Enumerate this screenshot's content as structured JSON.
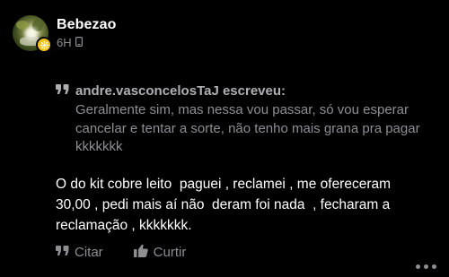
{
  "post": {
    "author": "Bebezao",
    "time": "6H",
    "quote": {
      "author_line": "andre.vasconcelosTaJ escreveu:",
      "text": "Geralmente sim, mas nessa vou passar, só vou esperar cancelar e tentar a sorte, não tenho mais grana pra pagar kkkkkkk"
    },
    "body": "O do kit cobre leito  paguei , reclamei , me ofereceram 30,00 , pedi mais aí não  deram foi nada  , fecharam a reclamação , kkkkkkk.",
    "actions": {
      "quote_label": "Citar",
      "like_label": "Curtir"
    }
  },
  "icons": {
    "quote": "quote-icon",
    "like": "thumbs-up-icon",
    "device": "mobile-device-icon",
    "badge": "gold-badge-icon",
    "more": "more-options-icon"
  },
  "colors": {
    "background": "#000000",
    "primary_text": "#ffffff",
    "secondary_text": "#8e8e93",
    "badge": "#f4c21b"
  }
}
